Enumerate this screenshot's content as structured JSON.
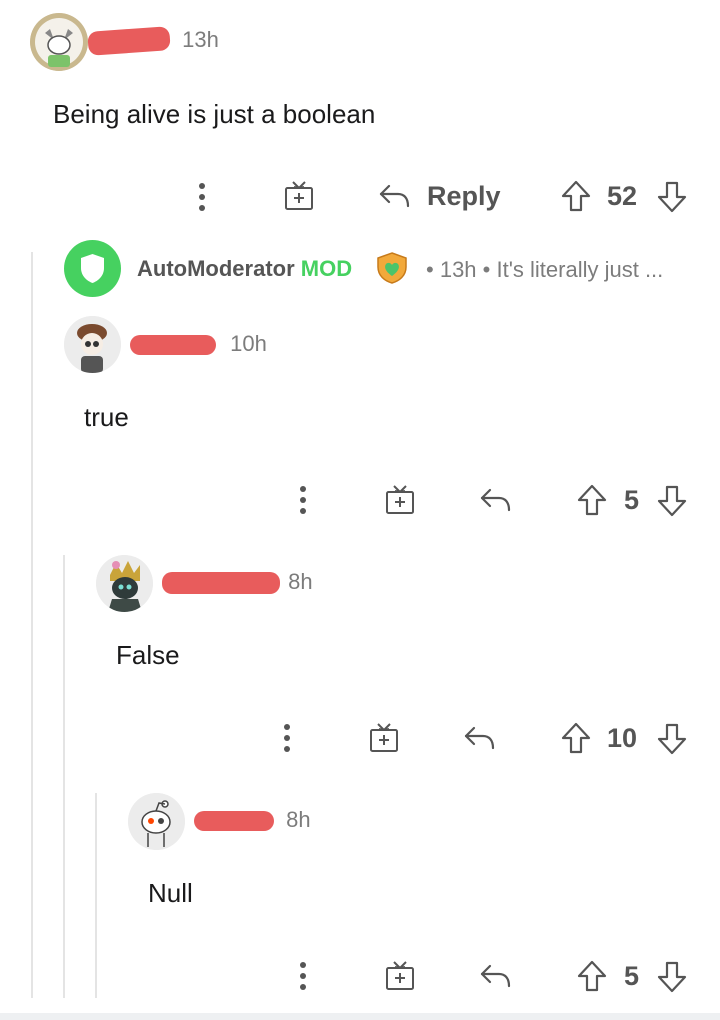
{
  "comments": [
    {
      "time": "13h",
      "text": "Being alive is just a boolean",
      "reply_label": "Reply",
      "votes": "52"
    },
    {
      "time": "10h",
      "text": "true",
      "votes": "5"
    },
    {
      "time": "8h",
      "text": "False",
      "votes": "10"
    },
    {
      "time": "8h",
      "text": "Null",
      "votes": "5"
    }
  ],
  "automod": {
    "name": "AutoModerator",
    "badge": "MOD",
    "time": "13h",
    "preview": "It's literally just ..."
  },
  "colors": {
    "mod_green": "#46d160",
    "redaction": "#e85c5c",
    "text": "#1a1a1b",
    "muted": "#7c7c7c"
  },
  "icons": {
    "more": "more-vertical-icon",
    "award": "gift-icon",
    "reply": "reply-arrow-icon",
    "upvote": "upvote-arrow-icon",
    "downvote": "downvote-arrow-icon"
  }
}
